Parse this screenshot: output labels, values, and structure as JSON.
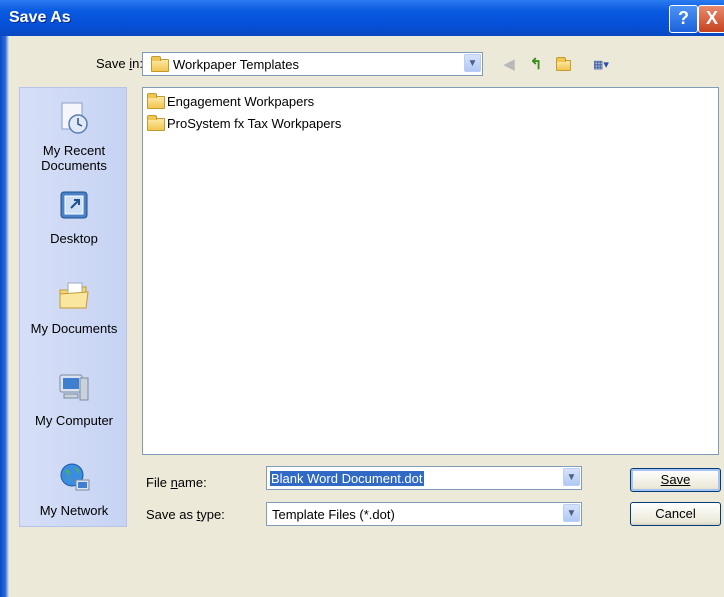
{
  "window": {
    "title": "Save As"
  },
  "titlebar": {
    "help_glyph": "?",
    "close_glyph": "X"
  },
  "savein": {
    "label": "Save in:",
    "label_accel_char": "i",
    "value": "Workpaper Templates"
  },
  "toolbar": {
    "icons": [
      "back-icon",
      "up-folder-icon",
      "new-folder-icon",
      "views-menu-icon"
    ]
  },
  "places": [
    {
      "label_line1": "My Recent",
      "label_line2": "Documents",
      "icon": "recent-documents-icon"
    },
    {
      "label_line1": "Desktop",
      "label_line2": "",
      "icon": "desktop-icon"
    },
    {
      "label_line1": "My Documents",
      "label_line2": "",
      "icon": "my-documents-icon"
    },
    {
      "label_line1": "My Computer",
      "label_line2": "",
      "icon": "my-computer-icon"
    },
    {
      "label_line1": "My Network",
      "label_line2": "",
      "icon": "my-network-icon"
    }
  ],
  "files": [
    {
      "name": "Engagement Workpapers"
    },
    {
      "name": "ProSystem fx Tax Workpapers"
    }
  ],
  "filename": {
    "label": "File name:",
    "value": "Blank Word Document.dot"
  },
  "savetype": {
    "label": "Save as type:",
    "value": "Template Files (*.dot)"
  },
  "buttons": {
    "save": "Save",
    "cancel": "Cancel"
  },
  "colors": {
    "titlebar": "#0a5ae0",
    "selection": "#316ac5",
    "places_bar": "#c6d3f3"
  }
}
